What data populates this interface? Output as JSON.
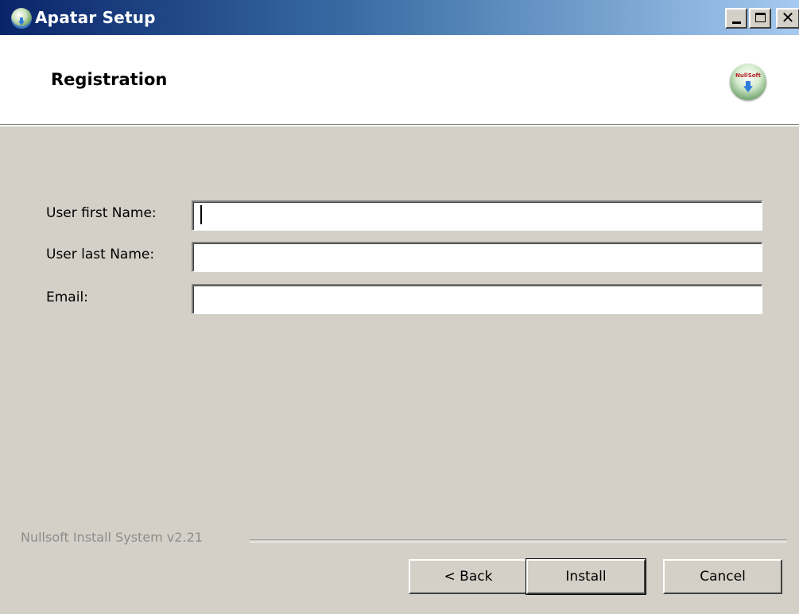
{
  "window": {
    "title": "Apatar Setup"
  },
  "header": {
    "title": "Registration",
    "logo_text": "NullSoft"
  },
  "form": {
    "first_name": {
      "label": "User first Name:",
      "value": ""
    },
    "last_name": {
      "label": "User last Name:",
      "value": ""
    },
    "email": {
      "label": "Email:",
      "value": ""
    }
  },
  "footer": {
    "branding": "Nullsoft Install System v2.21",
    "back_label": "< Back",
    "install_label": "Install",
    "cancel_label": "Cancel"
  },
  "colors": {
    "window_bg": "#d4d0c8",
    "titlebar_start": "#0a246a",
    "titlebar_end": "#a6caf0"
  }
}
